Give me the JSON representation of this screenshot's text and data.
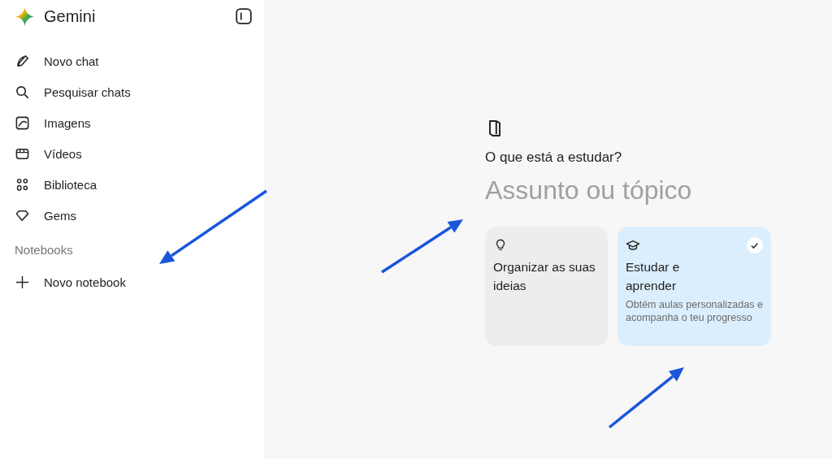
{
  "sidebar": {
    "title": "Gemini",
    "items": [
      {
        "label": "Novo chat",
        "kind": "pencil"
      },
      {
        "label": "Pesquisar chats",
        "kind": "search"
      },
      {
        "label": "Imagens",
        "kind": "image"
      },
      {
        "label": "Vídeos",
        "kind": "video"
      },
      {
        "label": "Biblioteca",
        "kind": "library"
      },
      {
        "label": "Gems",
        "kind": "gem"
      }
    ],
    "section_heading": "Notebooks",
    "section_items": [
      {
        "label": "Novo notebook",
        "kind": "plus"
      }
    ]
  },
  "main": {
    "question": "O que está a estudar?",
    "input": {
      "placeholder": "Assunto ou tópico"
    },
    "options": [
      {
        "title": "Organizar as suas ideias",
        "kind": "bulb",
        "selected": false
      },
      {
        "title": "Estudar e aprender",
        "kind": "cap",
        "selected": true,
        "description": "Obtém aulas personalizadas e acompanha o teu progresso"
      }
    ]
  },
  "annotations": [
    {
      "kind": "arrow"
    },
    {
      "kind": "arrow"
    },
    {
      "kind": "arrow"
    }
  ]
}
